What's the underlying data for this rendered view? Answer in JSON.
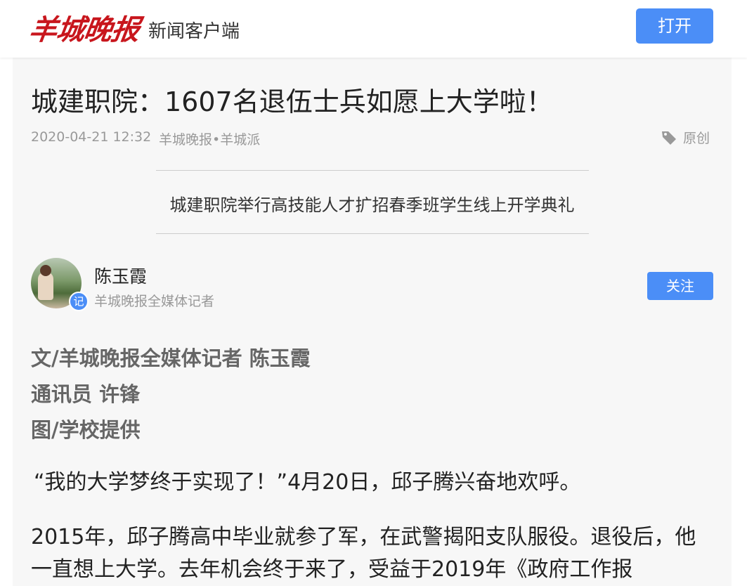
{
  "header": {
    "logo_text": "羊城晚报",
    "app_name": "新闻客户端",
    "open_label": "打开",
    "accent_color": "#4b8ef7",
    "logo_color": "#c8161d"
  },
  "article": {
    "title": "城建职院：1607名退伍士兵如愿上大学啦！",
    "time": "2020-04-21 12:32",
    "source": "羊城晚报•羊城派",
    "original_label": "原创",
    "original_icon": "tag-icon",
    "caption": "城建职院举行高技能人才扩招春季班学生线上开学典礼"
  },
  "author": {
    "name": "陈玉霞",
    "role": "羊城晚报全媒体记者",
    "badge": "记",
    "follow_label": "关注"
  },
  "byline": [
    "文/羊城晚报全媒体记者 陈玉霞",
    "通讯员 许锋",
    "图/学校提供"
  ],
  "paragraphs": [
    "“我的大学梦终于实现了！”4月20日，邱子腾兴奋地欢呼。",
    "2015年，邱子腾高中毕业就参了军，在武警揭阳支队服役。退役后，他一直想上大学。去年机会终于来了，受益于2019年《政府工作报"
  ]
}
